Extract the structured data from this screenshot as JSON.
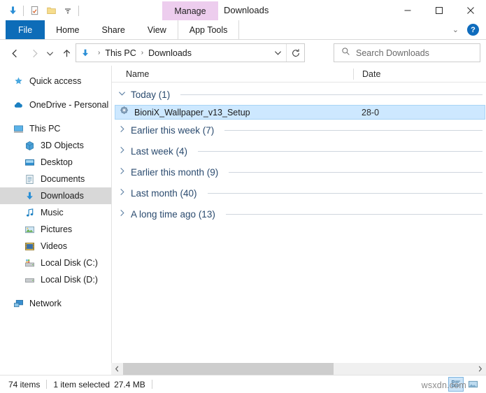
{
  "window": {
    "title": "Downloads",
    "contextual_tab": "Manage",
    "minimize": "—",
    "maximize": "☐",
    "close": "✕"
  },
  "quick_access_toolbar": {
    "items": [
      {
        "name": "downloads-icon",
        "label": "Downloads"
      },
      {
        "name": "properties-icon",
        "label": "Properties"
      },
      {
        "name": "new-folder-icon",
        "label": "New folder"
      },
      {
        "name": "customize-chevron-icon",
        "label": "Customize Quick Access Toolbar"
      }
    ]
  },
  "ribbon": {
    "tabs": [
      {
        "label": "File",
        "id": "file",
        "active": true
      },
      {
        "label": "Home",
        "id": "home",
        "active": false
      },
      {
        "label": "Share",
        "id": "share",
        "active": false
      },
      {
        "label": "View",
        "id": "view",
        "active": false
      },
      {
        "label": "App Tools",
        "id": "apptools",
        "active": false
      }
    ],
    "collapse_chevron": "⌄",
    "help_label": "?"
  },
  "navigation": {
    "back": "←",
    "forward": "→",
    "recent": "⌄",
    "up": "↑",
    "refresh": "↻",
    "address_dropdown": "⌄",
    "breadcrumbs": [
      "This PC",
      "Downloads"
    ],
    "breadcrumb_separator": "›"
  },
  "search": {
    "placeholder": "Search Downloads",
    "value": "",
    "icon": "search-icon"
  },
  "sidebar": {
    "items": [
      {
        "label": "Quick access",
        "icon": "star-icon",
        "indent": false,
        "selected": false
      },
      {
        "label": "OneDrive - Personal",
        "icon": "cloud-icon",
        "indent": false,
        "selected": false
      },
      {
        "label": "This PC",
        "icon": "monitor-icon",
        "indent": false,
        "selected": false
      },
      {
        "label": "3D Objects",
        "icon": "cube-icon",
        "indent": true,
        "selected": false
      },
      {
        "label": "Desktop",
        "icon": "desktop-icon",
        "indent": true,
        "selected": false
      },
      {
        "label": "Documents",
        "icon": "document-icon",
        "indent": true,
        "selected": false
      },
      {
        "label": "Downloads",
        "icon": "download-arrow-icon",
        "indent": true,
        "selected": true
      },
      {
        "label": "Music",
        "icon": "music-note-icon",
        "indent": true,
        "selected": false
      },
      {
        "label": "Pictures",
        "icon": "picture-icon",
        "indent": true,
        "selected": false
      },
      {
        "label": "Videos",
        "icon": "video-icon",
        "indent": true,
        "selected": false
      },
      {
        "label": "Local Disk (C:)",
        "icon": "system-drive-icon",
        "indent": true,
        "selected": false
      },
      {
        "label": "Local Disk (D:)",
        "icon": "drive-icon",
        "indent": true,
        "selected": false
      },
      {
        "label": "Network",
        "icon": "network-icon",
        "indent": false,
        "selected": false
      }
    ]
  },
  "file_list": {
    "columns": [
      {
        "label": "Name",
        "id": "name"
      },
      {
        "label": "Date",
        "id": "date"
      }
    ],
    "groups": [
      {
        "label": "Today (1)",
        "expanded": true,
        "chevron": "⌄",
        "files": [
          {
            "name": "BioniX_Wallpaper_v13_Setup",
            "date": "28-0",
            "icon": "installer-icon",
            "selected": true
          }
        ]
      },
      {
        "label": "Earlier this week (7)",
        "expanded": false,
        "chevron": "›",
        "files": []
      },
      {
        "label": "Last week (4)",
        "expanded": false,
        "chevron": "›",
        "files": []
      },
      {
        "label": "Earlier this month (9)",
        "expanded": false,
        "chevron": "›",
        "files": []
      },
      {
        "label": "Last month (40)",
        "expanded": false,
        "chevron": "›",
        "files": []
      },
      {
        "label": "A long time ago (13)",
        "expanded": false,
        "chevron": "›",
        "files": []
      }
    ]
  },
  "scrollbar": {
    "left_arrow": "‹",
    "right_arrow": "›"
  },
  "status_bar": {
    "item_count": "74 items",
    "selection_info": "1 item selected",
    "selection_size": "27.4 MB",
    "views": [
      {
        "name": "details-view-button",
        "active": true
      },
      {
        "name": "large-icons-view-button",
        "active": false
      }
    ]
  },
  "watermark": {
    "text": "wsxdn.com"
  },
  "colors": {
    "file_tab": "#0d6cb8",
    "contextual_tab": "#edcdee",
    "selection": "#cde8ff",
    "sidebar_selection": "#d8d8d8",
    "group_label": "#2b4b6f",
    "accent": "#0f6cbd"
  }
}
